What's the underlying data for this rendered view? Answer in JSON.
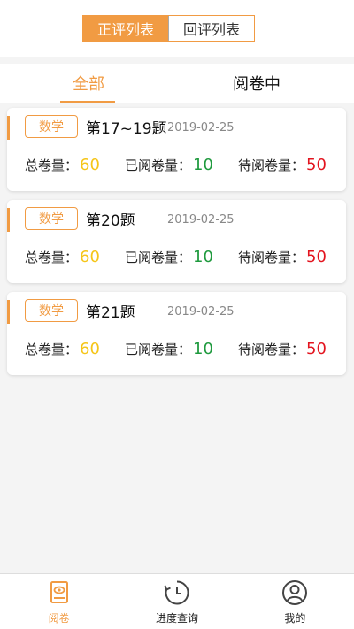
{
  "header": {
    "tabs": [
      "正评列表",
      "回评列表"
    ],
    "active_index": 0
  },
  "subtabs": {
    "items": [
      "全部",
      "阅卷中"
    ],
    "active_index": 0
  },
  "labels": {
    "total": "总卷量：",
    "done": "已阅卷量：",
    "pending": "待阅卷量："
  },
  "cards": [
    {
      "subject": "数学",
      "title": "第17~19题",
      "date": "2019-02-25",
      "total": "60",
      "done": "10",
      "pending": "50"
    },
    {
      "subject": "数学",
      "title": "第20题",
      "date": "2019-02-25",
      "total": "60",
      "done": "10",
      "pending": "50"
    },
    {
      "subject": "数学",
      "title": "第21题",
      "date": "2019-02-25",
      "total": "60",
      "done": "10",
      "pending": "50"
    }
  ],
  "bottom_nav": [
    {
      "label": "阅卷",
      "icon": "paper-eye-icon",
      "active": true
    },
    {
      "label": "进度查询",
      "icon": "clock-history-icon",
      "active": false
    },
    {
      "label": "我的",
      "icon": "user-icon",
      "active": false
    }
  ],
  "colors": {
    "accent": "#f19b43",
    "total": "#f5c518",
    "done": "#1f9a3e",
    "pending": "#e3141f"
  }
}
